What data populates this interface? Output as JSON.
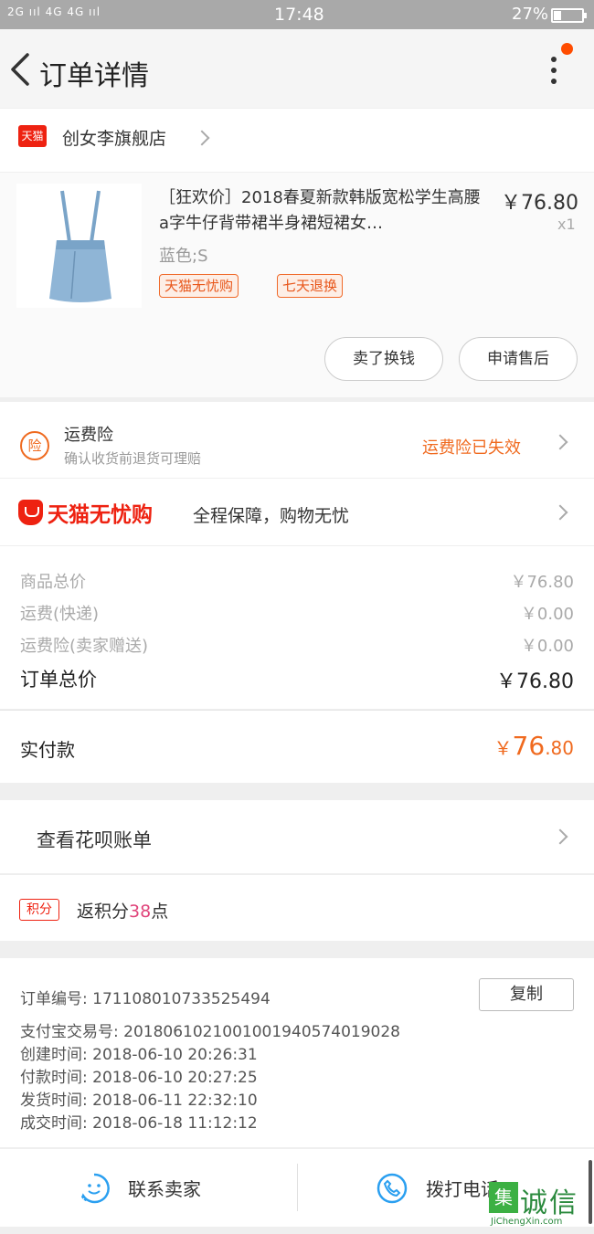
{
  "status_bar": {
    "signal": "2G ııl 4G 4G ııl",
    "time": "17:48",
    "battery_text": "27%",
    "battery_level": 0.27
  },
  "header": {
    "title": "订单详情"
  },
  "store": {
    "badge": "天猫",
    "name": "创女李旗舰店"
  },
  "product": {
    "title": "［狂欢价］2018春夏新款韩版宽松学生高腰a字牛仔背带裙半身裙短裙女…",
    "sku": "蓝色;S",
    "price": "￥76.80",
    "qty": "x1",
    "badges": [
      "天猫无忧购",
      "七天退换"
    ],
    "actions": [
      "卖了换钱",
      "申请售后"
    ]
  },
  "insurance": {
    "icon_text": "险",
    "title": "运费险",
    "subtitle": "确认收货前退货可理赔",
    "status": "运费险已失效"
  },
  "tmall_guarantee": {
    "logo_text": "天猫无忧购",
    "desc": "全程保障，购物无忧"
  },
  "costs": {
    "rows": [
      {
        "label": "商品总价",
        "value": "￥76.80"
      },
      {
        "label": "运费(快递)",
        "value": "￥0.00"
      },
      {
        "label": "运费险(卖家赠送)",
        "value": "￥0.00"
      }
    ],
    "total_label": "订单总价",
    "total_value": "￥76.80",
    "paid_label": "实付款",
    "paid_currency": "￥",
    "paid_int": "76",
    "paid_dec": ".80"
  },
  "huabei": {
    "label": "查看花呗账单"
  },
  "points": {
    "badge": "积分",
    "prefix": "返积分",
    "num": "38",
    "suffix": "点"
  },
  "order_info": {
    "lines": [
      "订单编号:   171108010733525494",
      "支付宝交易号:   2018061021001001940574019028",
      "创建时间:   2018-06-10 20:26:31",
      "付款时间:   2018-06-10 20:27:25",
      "发货时间:   2018-06-11 22:32:10",
      "成交时间:   2018-06-18 11:12:12"
    ],
    "copy_label": "复制"
  },
  "bottom": {
    "contact_label": "联系卖家",
    "call_label": "拨打电话"
  },
  "watermark": {
    "box": "集",
    "name": "诚信",
    "url": "JiChengXin.com"
  },
  "colors": {
    "accent_orange": "#f06a1f",
    "tmall_red": "#ee2211",
    "icon_blue": "#2a9ff0"
  }
}
